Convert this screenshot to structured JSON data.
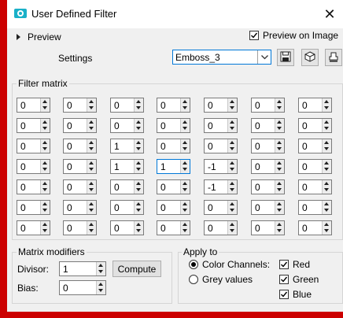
{
  "window": {
    "title": "User Defined Filter",
    "close_label": "✕"
  },
  "preview": {
    "label": "Preview",
    "preview_on_image_label": "Preview on Image",
    "preview_on_image_checked": true
  },
  "settings": {
    "label": "Settings",
    "value": "Emboss_3"
  },
  "filter_matrix": {
    "label": "Filter matrix",
    "rows": [
      [
        "0",
        "0",
        "0",
        "0",
        "0",
        "0",
        "0"
      ],
      [
        "0",
        "0",
        "0",
        "0",
        "0",
        "0",
        "0"
      ],
      [
        "0",
        "0",
        "1",
        "0",
        "0",
        "0",
        "0"
      ],
      [
        "0",
        "0",
        "1",
        "1",
        "-1",
        "0",
        "0"
      ],
      [
        "0",
        "0",
        "0",
        "0",
        "-1",
        "0",
        "0"
      ],
      [
        "0",
        "0",
        "0",
        "0",
        "0",
        "0",
        "0"
      ],
      [
        "0",
        "0",
        "0",
        "0",
        "0",
        "0",
        "0"
      ]
    ]
  },
  "modifiers": {
    "label": "Matrix modifiers",
    "divisor_label": "Divisor:",
    "divisor_value": "1",
    "bias_label": "Bias:",
    "bias_value": "0",
    "compute_label": "Compute"
  },
  "apply_to": {
    "label": "Apply to",
    "color_channels_label": "Color Channels:",
    "grey_values_label": "Grey values",
    "selected": "color_channels",
    "red_label": "Red",
    "green_label": "Green",
    "blue_label": "Blue",
    "red_checked": true,
    "green_checked": true,
    "blue_checked": true
  },
  "colors": {
    "background_border": "#cc0000",
    "dialog_bg": "#f0f0f0",
    "focus_blue": "#0078d7",
    "icon_teal": "#1ab0c8"
  }
}
